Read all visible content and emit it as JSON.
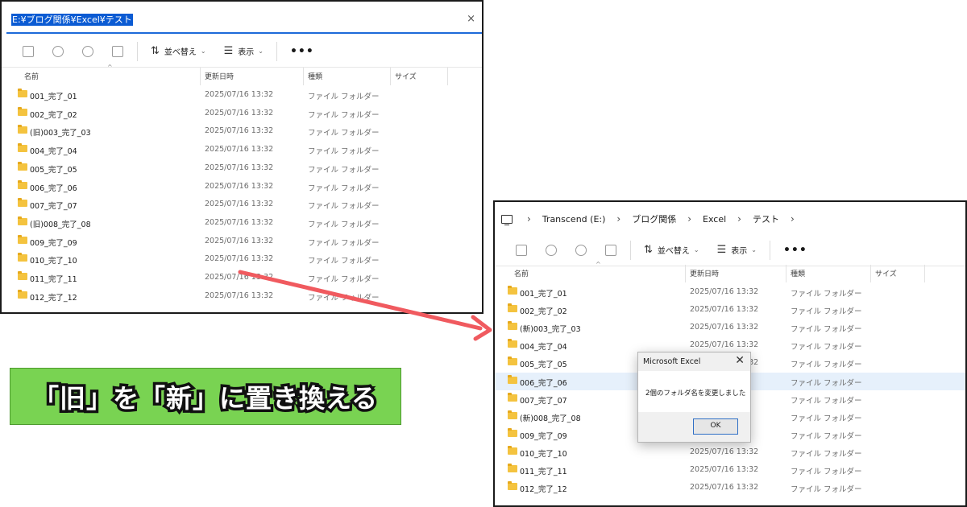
{
  "left": {
    "address_path": "E:¥ブログ関係¥Excel¥テスト",
    "close_glyph": "×",
    "toolbar": {
      "sort_label": "並べ替え",
      "view_label": "表示",
      "more_label": "•••"
    },
    "columns": {
      "name": "名前",
      "modified": "更新日時",
      "type": "種類",
      "size": "サイズ"
    },
    "rows": [
      {
        "name": "001_完了_01",
        "modified": "2025/07/16 13:32",
        "type": "ファイル フォルダー"
      },
      {
        "name": "002_完了_02",
        "modified": "2025/07/16 13:32",
        "type": "ファイル フォルダー"
      },
      {
        "name": "(旧)003_完了_03",
        "modified": "2025/07/16 13:32",
        "type": "ファイル フォルダー"
      },
      {
        "name": "004_完了_04",
        "modified": "2025/07/16 13:32",
        "type": "ファイル フォルダー"
      },
      {
        "name": "005_完了_05",
        "modified": "2025/07/16 13:32",
        "type": "ファイル フォルダー"
      },
      {
        "name": "006_完了_06",
        "modified": "2025/07/16 13:32",
        "type": "ファイル フォルダー"
      },
      {
        "name": "007_完了_07",
        "modified": "2025/07/16 13:32",
        "type": "ファイル フォルダー"
      },
      {
        "name": "(旧)008_完了_08",
        "modified": "2025/07/16 13:32",
        "type": "ファイル フォルダー"
      },
      {
        "name": "009_完了_09",
        "modified": "2025/07/16 13:32",
        "type": "ファイル フォルダー"
      },
      {
        "name": "010_完了_10",
        "modified": "2025/07/16 13:32",
        "type": "ファイル フォルダー"
      },
      {
        "name": "011_完了_11",
        "modified": "2025/07/16 13:32",
        "type": "ファイル フォルダー"
      },
      {
        "name": "012_完了_12",
        "modified": "2025/07/16 13:32",
        "type": "ファイル フォルダー"
      }
    ]
  },
  "right": {
    "breadcrumb": [
      "Transcend (E:)",
      "ブログ関係",
      "Excel",
      "テスト"
    ],
    "breadcrumb_sep": "›",
    "toolbar": {
      "sort_label": "並べ替え",
      "view_label": "表示",
      "more_label": "•••"
    },
    "columns": {
      "name": "名前",
      "modified": "更新日時",
      "type": "種類",
      "size": "サイズ"
    },
    "rows": [
      {
        "name": "001_完了_01",
        "modified": "2025/07/16 13:32",
        "type": "ファイル フォルダー"
      },
      {
        "name": "002_完了_02",
        "modified": "2025/07/16 13:32",
        "type": "ファイル フォルダー"
      },
      {
        "name": "(新)003_完了_03",
        "modified": "2025/07/16 13:32",
        "type": "ファイル フォルダー"
      },
      {
        "name": "004_完了_04",
        "modified": "2025/07/16 13:32",
        "type": "ファイル フォルダー"
      },
      {
        "name": "005_完了_05",
        "modified": "2025/07/16 13:32",
        "type": "ファイル フォルダー"
      },
      {
        "name": "006_完了_06",
        "modified": "",
        "type": "ファイル フォルダー"
      },
      {
        "name": "007_完了_07",
        "modified": "",
        "type": "ファイル フォルダー"
      },
      {
        "name": "(新)008_完了_08",
        "modified": "",
        "type": "ファイル フォルダー"
      },
      {
        "name": "009_完了_09",
        "modified": "",
        "type": "ファイル フォルダー"
      },
      {
        "name": "010_完了_10",
        "modified": "2025/07/16 13:32",
        "type": "ファイル フォルダー"
      },
      {
        "name": "011_完了_11",
        "modified": "2025/07/16 13:32",
        "type": "ファイル フォルダー"
      },
      {
        "name": "012_完了_12",
        "modified": "2025/07/16 13:32",
        "type": "ファイル フォルダー"
      }
    ],
    "selected_row_index": 5
  },
  "dialog": {
    "title": "Microsoft Excel",
    "close_glyph": "✕",
    "message": "2個のフォルダ名を変更しました",
    "ok_label": "OK"
  },
  "banner": {
    "text": "「旧」を「新」に置き換える"
  },
  "colors": {
    "banner_fill": "#79d352",
    "arrow": "#f05a5f",
    "selection": "#0b5bd3",
    "folder": "#f4c33f"
  }
}
